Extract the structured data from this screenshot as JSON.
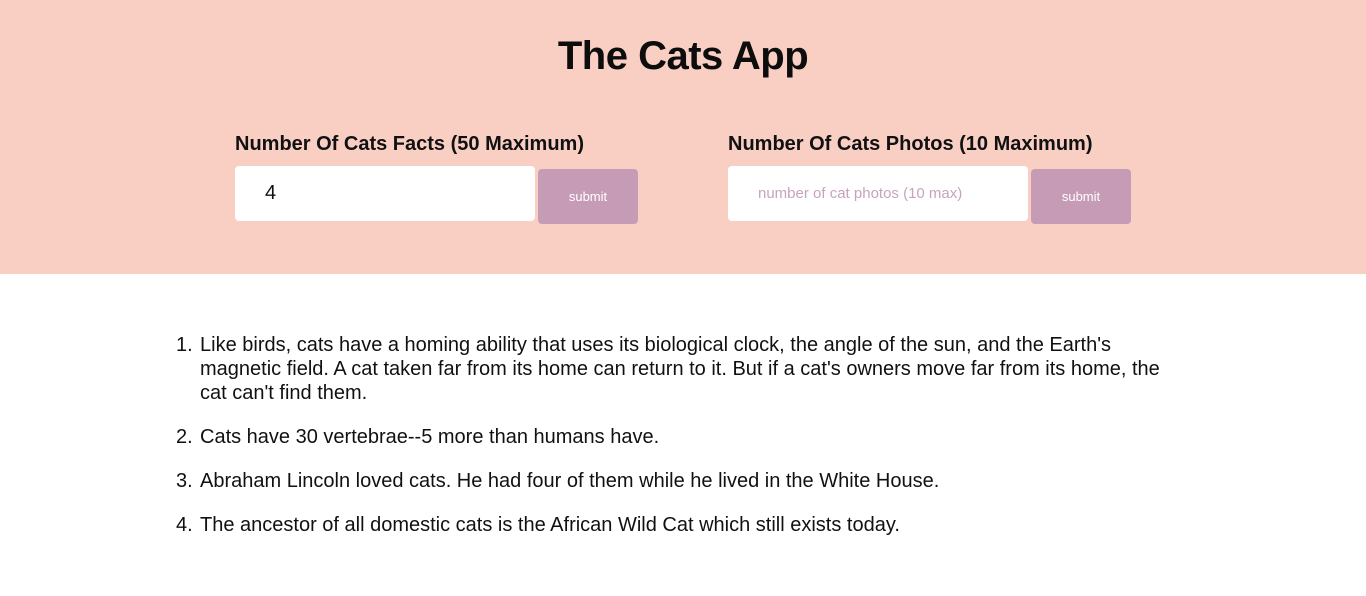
{
  "header": {
    "title": "The Cats App",
    "background": "#f9cfc4"
  },
  "facts_form": {
    "label": "Number Of Cats Facts (50 Maximum)",
    "value": "4",
    "submit_label": "submit"
  },
  "photos_form": {
    "label": "Number Of Cats Photos (10 Maximum)",
    "placeholder": "number of cat photos (10 max)",
    "value": "",
    "submit_label": "submit"
  },
  "button_color": "#c69bb6",
  "facts": [
    {
      "number": "1.",
      "text": "Like birds, cats have a homing ability that uses its biological clock, the angle of the sun, and the Earth's magnetic field. A cat taken far from its home can return to it. But if a cat's owners move far from its home, the cat can't find them."
    },
    {
      "number": "2.",
      "text": "Cats have 30 vertebrae--5 more than humans have."
    },
    {
      "number": "3.",
      "text": "Abraham Lincoln loved cats. He had four of them while he lived in the White House."
    },
    {
      "number": "4.",
      "text": "The ancestor of all domestic cats is the African Wild Cat which still exists today."
    }
  ]
}
